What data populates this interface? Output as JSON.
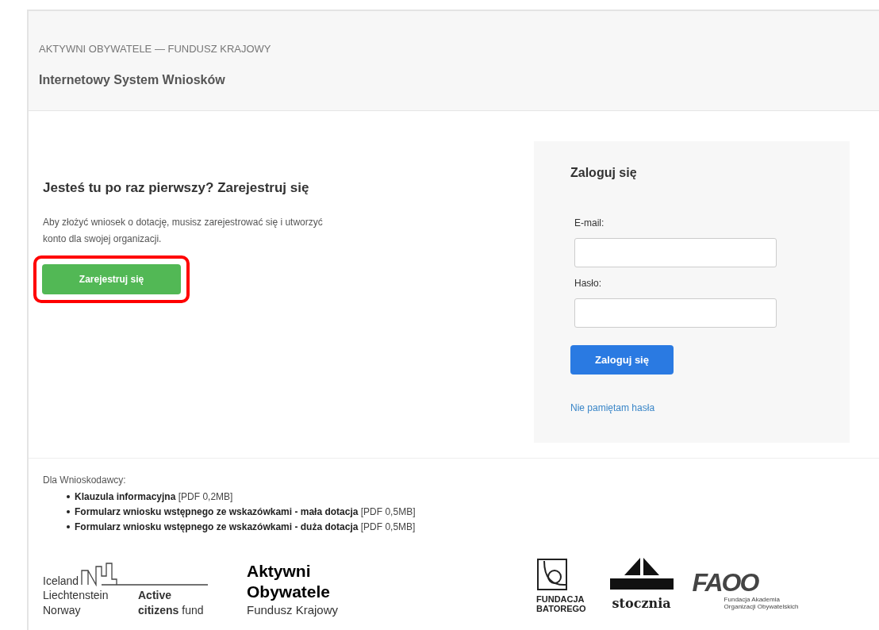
{
  "header": {
    "org_line": "AKTYWNI OBYWATELE — FUNDUSZ KRAJOWY",
    "system_title": "Internetowy System Wniosków"
  },
  "register": {
    "heading": "Jesteś tu po raz pierwszy? Zarejestruj się",
    "description": "Aby złożyć wniosek o dotację, musisz zarejestrować się i utworzyć konto dla swojej organizacji.",
    "button": {
      "label": "Zarejestruj się",
      "highlighted": true
    }
  },
  "login": {
    "heading": "Zaloguj się",
    "fields": [
      {
        "label": "E-mail:"
      },
      {
        "label": "Hasło:"
      }
    ],
    "button": "Zaloguj się",
    "forgot_link": "Nie pamiętam hasła"
  },
  "footer": {
    "intro": "Dla Wnioskodawcy:",
    "documents": [
      {
        "title": "Klauzula informacyjna",
        "info": "[PDF 0,2MB]"
      },
      {
        "title": "Formularz wniosku wstępnego ze wskazówkami - mała dotacja",
        "info": "[PDF 0,5MB]"
      },
      {
        "title": "Formularz wniosku wstępnego ze wskazówkami - duża dotacja",
        "info": "[PDF 0,5MB]"
      }
    ],
    "logos": {
      "countries": [
        "Iceland",
        "Liechtenstein",
        "Norway"
      ],
      "fund_bold_1": "Active",
      "fund_bold_2": "citizens",
      "fund_rest": "fund",
      "ao_line_1": "Aktywni",
      "ao_line_2": "Obywatele",
      "ao_line_3": "Fundusz Krajowy",
      "batory_1": "FUNDACJA",
      "batory_2": "BATOREGO",
      "stocznia": "stocznia",
      "faoo": "FAOO",
      "faoo_caption": "Fundacja Akademia Organizacji Obywatelskich"
    }
  }
}
